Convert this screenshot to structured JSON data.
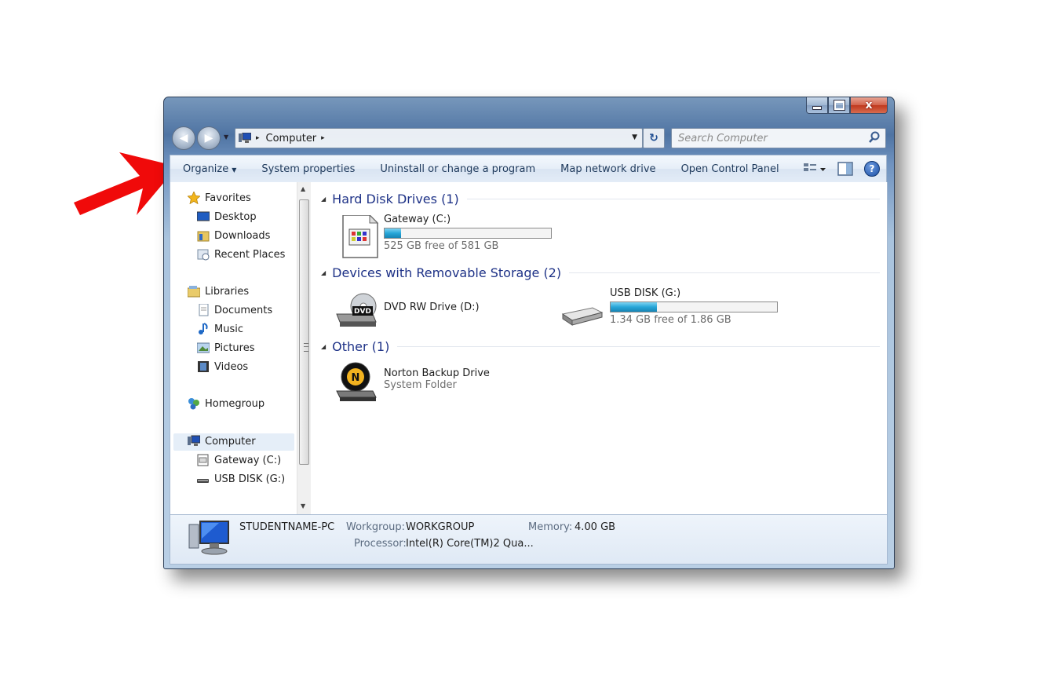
{
  "annotation": {
    "arrow_color": "#f00a0a",
    "arrow_target": "Organize"
  },
  "window": {
    "controls": {
      "minimize_icon": "minimize-icon",
      "maximize_icon": "maximize-icon",
      "close_label": "x"
    }
  },
  "nav": {
    "back_icon": "back-arrow-icon",
    "forward_icon": "forward-arrow-icon"
  },
  "address": {
    "path": "Computer",
    "separator": "▸"
  },
  "search": {
    "placeholder": "Search Computer"
  },
  "toolbar": {
    "organize": "Organize",
    "system_properties": "System properties",
    "uninstall": "Uninstall or change a program",
    "map_drive": "Map network drive",
    "control_panel": "Open Control Panel"
  },
  "sidebar": {
    "favorites": {
      "label": "Favorites",
      "items": [
        "Desktop",
        "Downloads",
        "Recent Places"
      ]
    },
    "libraries": {
      "label": "Libraries",
      "items": [
        "Documents",
        "Music",
        "Pictures",
        "Videos"
      ]
    },
    "homegroup": "Homegroup",
    "computer": {
      "label": "Computer",
      "items": [
        "Gateway (C:)",
        "USB DISK (G:)"
      ]
    }
  },
  "groups": {
    "hdd": {
      "title": "Hard Disk Drives (1)",
      "drives": [
        {
          "name": "Gateway (C:)",
          "free": "525 GB free of 581 GB",
          "used_fraction": 0.097
        }
      ]
    },
    "removable": {
      "title": "Devices with Removable Storage (2)",
      "drives": [
        {
          "name": "DVD RW Drive (D:)"
        },
        {
          "name": "USB DISK (G:)",
          "free": "1.34 GB free of 1.86 GB",
          "used_fraction": 0.28
        }
      ]
    },
    "other": {
      "title": "Other (1)",
      "items": [
        {
          "name": "Norton Backup Drive",
          "sub": "System Folder"
        }
      ]
    }
  },
  "details": {
    "pc_name": "STUDENTNAME-PC",
    "workgroup_label": "Workgroup:",
    "workgroup": "WORKGROUP",
    "memory_label": "Memory:",
    "memory": "4.00 GB",
    "processor_label": "Processor:",
    "processor": "Intel(R) Core(TM)2 Qua..."
  }
}
